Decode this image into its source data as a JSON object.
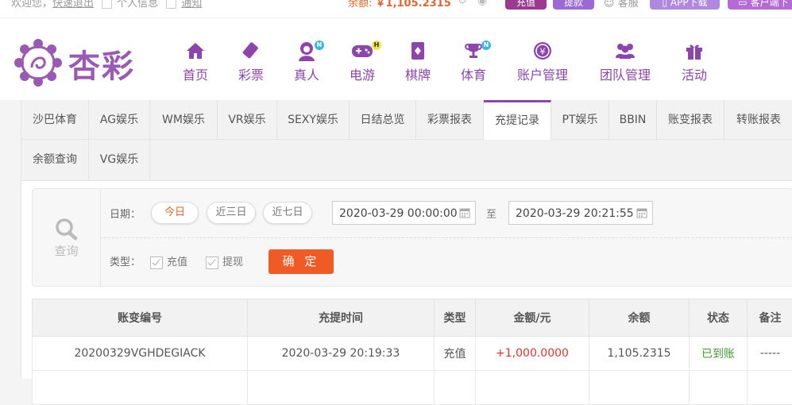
{
  "topbar": {
    "greeting_partial": "欢迎您，",
    "greeting_link": "快速退出",
    "personal_info": "个人信息",
    "notice_partial": "",
    "notice_link": "通知",
    "balance_label": "余额:",
    "balance_value": "￥1,105.2315",
    "deposit_label": "充值",
    "withdraw_label": "提款",
    "service_label": "客服",
    "app_download_label": "APP下载",
    "client_download_label": "客户端下",
    "colors": {
      "deposit": "#9b3a8e",
      "withdraw": "#9b6ad6",
      "app": "#b088e0",
      "client": "#b56ad6"
    }
  },
  "logo": {
    "text": "杏彩",
    "icon": "grape-logo-icon"
  },
  "nav": [
    {
      "label": "首页",
      "icon": "home-icon"
    },
    {
      "label": "彩票",
      "icon": "lottery-ticket-icon"
    },
    {
      "label": "真人",
      "icon": "live-dealer-icon",
      "badge": "N"
    },
    {
      "label": "电游",
      "icon": "gamepad-icon",
      "badge": "H"
    },
    {
      "label": "棋牌",
      "icon": "cards-icon"
    },
    {
      "label": "体育",
      "icon": "trophy-icon",
      "badge": "N"
    },
    {
      "label": "账户管理",
      "icon": "yen-coin-icon"
    },
    {
      "label": "团队管理",
      "icon": "team-icon"
    },
    {
      "label": "活动",
      "icon": "gift-icon"
    }
  ],
  "tabs": [
    "沙巴体育",
    "AG娱乐",
    "WM娱乐",
    "VR娱乐",
    "SEXY娱乐",
    "日结总览",
    "彩票报表",
    "充提记录",
    "PT娱乐",
    "BBIN",
    "账变报表",
    "转账报表",
    "余额查询",
    "VG娱乐"
  ],
  "active_tab": "充提记录",
  "query": {
    "side_label": "查询",
    "date_label": "日期：",
    "ranges": [
      "今日",
      "近三日",
      "近七日"
    ],
    "active_range": "今日",
    "start": "2020-03-29 00:00:00",
    "to_label": "至",
    "end": "2020-03-29 20:21:55",
    "type_label": "类型：",
    "types": [
      "充值",
      "提现"
    ],
    "confirm_label": "确 定"
  },
  "table": {
    "headers": [
      "账变编号",
      "充提时间",
      "类型",
      "金额/元",
      "余额",
      "状态",
      "备注"
    ],
    "rows": [
      {
        "id": "20200329VGHDEGIACK",
        "time": "2020-03-29 20:19:33",
        "type": "充值",
        "amount": "+1,000.0000",
        "balance": "1,105.2315",
        "status": "已到账",
        "note": "-----"
      }
    ]
  },
  "colors": {
    "brand_purple": "#8e44ad",
    "accent_orange": "#e0662d",
    "confirm": "#f05a24",
    "amount_red": "#e0332e",
    "status_green": "#3c9e2e"
  }
}
